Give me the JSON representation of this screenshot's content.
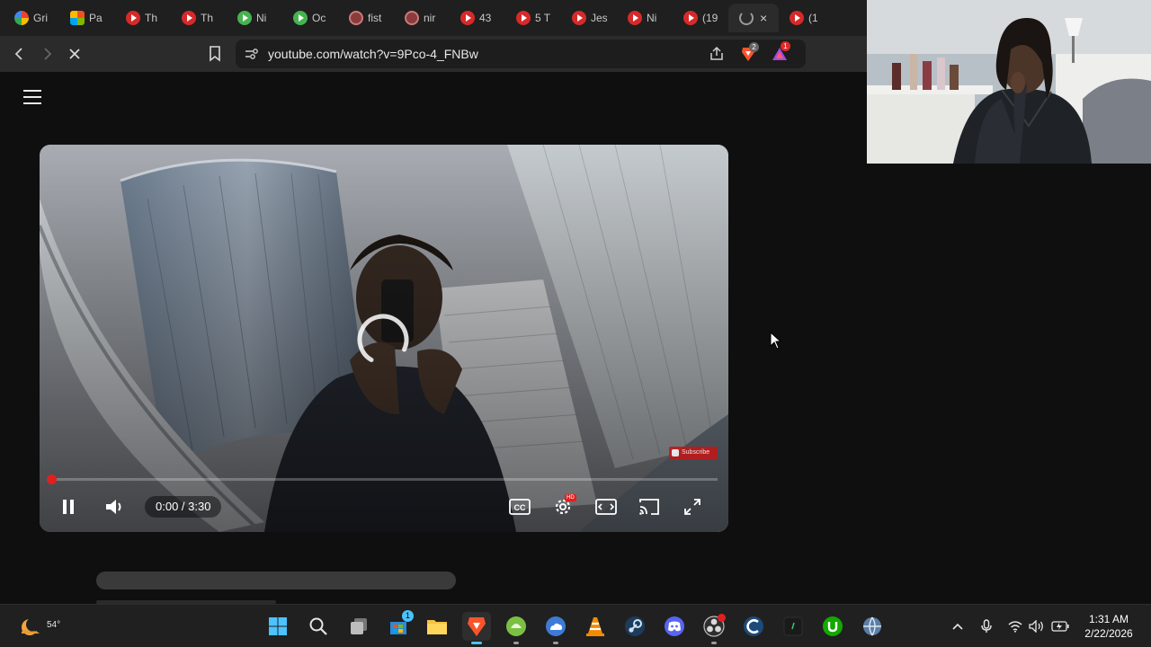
{
  "tabs": [
    {
      "icon": "google-icon",
      "label": "Gri"
    },
    {
      "icon": "windows-grid-icon",
      "label": "Pa"
    },
    {
      "icon": "youtube-icon",
      "label": "Th"
    },
    {
      "icon": "youtube-icon",
      "label": "Th"
    },
    {
      "icon": "play-icon",
      "label": "Ni"
    },
    {
      "icon": "play-icon",
      "label": "Oc"
    },
    {
      "icon": "shield-icon",
      "label": "fist"
    },
    {
      "icon": "shield-icon",
      "label": "nir"
    },
    {
      "icon": "youtube-icon",
      "label": "43"
    },
    {
      "icon": "youtube-icon",
      "label": "5 T"
    },
    {
      "icon": "youtube-icon",
      "label": "Jes"
    },
    {
      "icon": "youtube-icon",
      "label": "Ni"
    },
    {
      "icon": "youtube-icon",
      "label": "(19"
    },
    {
      "icon": "loading-icon",
      "label": ""
    },
    {
      "icon": "youtube-icon",
      "label": "(1"
    }
  ],
  "active_tab_close": "×",
  "address_bar": {
    "url": "youtube.com/watch?v=9Pco-4_FNBw",
    "brave_shield_count": "2",
    "rewards_count": "1"
  },
  "player": {
    "time": "0:00 / 3:30",
    "progress": 0.0,
    "watermark": "Subscribe",
    "quality_badge": "HD"
  },
  "taskbar": {
    "weather_temp": "54°",
    "store_badge": "1",
    "time": "1:31 AM",
    "date": "2/22/2026"
  },
  "colors": {
    "youtube_red": "#e02020",
    "taskbar_bg": "#202020",
    "page_bg": "#0f0f0f"
  }
}
